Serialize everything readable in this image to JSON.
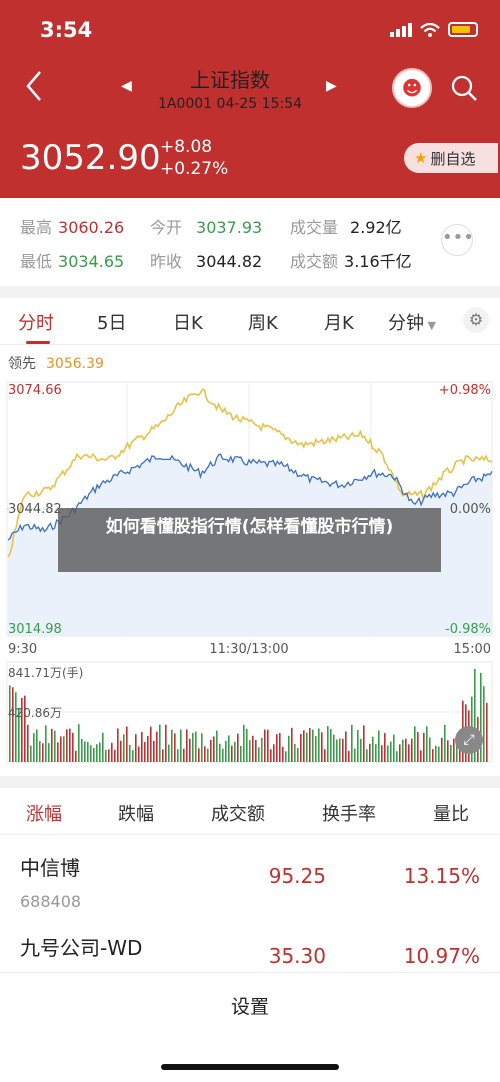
{
  "status_bar": {
    "time": "3:54"
  },
  "header": {
    "title": "上证指数",
    "subtitle": "1A0001 04-25 15:54",
    "price": "3052.90",
    "change": "+8.08",
    "change_pct": "+0.27%",
    "fav_label": "删自选"
  },
  "stats": {
    "high_label": "最高",
    "high_value": "3060.26",
    "open_label": "今开",
    "open_value": "3037.93",
    "volume_label": "成交量",
    "volume_value": "2.92亿",
    "low_label": "最低",
    "low_value": "3034.65",
    "prev_label": "昨收",
    "prev_value": "3044.82",
    "amount_label": "成交额",
    "amount_value": "3.16千亿"
  },
  "chart_tabs": [
    "分时",
    "5日",
    "日K",
    "周K",
    "月K",
    "分钟"
  ],
  "chart": {
    "leader_label": "领先",
    "leader_value": "3056.39",
    "y_top": "3074.66",
    "y_mid": "3044.82",
    "y_bottom": "3014.98",
    "pct_top": "+0.98%",
    "pct_mid": "0.00%",
    "pct_bottom": "-0.98%",
    "x_labels": [
      "9:30",
      "11:30/13:00",
      "15:00"
    ],
    "vol_top": "841.71万(手)",
    "vol_mid": "420.86万",
    "colors": {
      "up": "#c0302f",
      "down": "#3a9b4a",
      "price_line": "#3b6fc0",
      "avg_line": "#e6c24a"
    }
  },
  "overlay_text": "如何看懂股指行情(怎样看懂股市行情)",
  "rank_tabs": [
    "涨幅",
    "跌幅",
    "成交额",
    "换手率",
    "量比"
  ],
  "rank_rows": [
    {
      "name": "中信博",
      "code": "688408",
      "price": "95.25",
      "pct": "13.15%"
    },
    {
      "name": "九号公司-WD",
      "code": "",
      "price": "35.30",
      "pct": "10.97%"
    }
  ],
  "sheet": {
    "settings_label": "设置"
  }
}
